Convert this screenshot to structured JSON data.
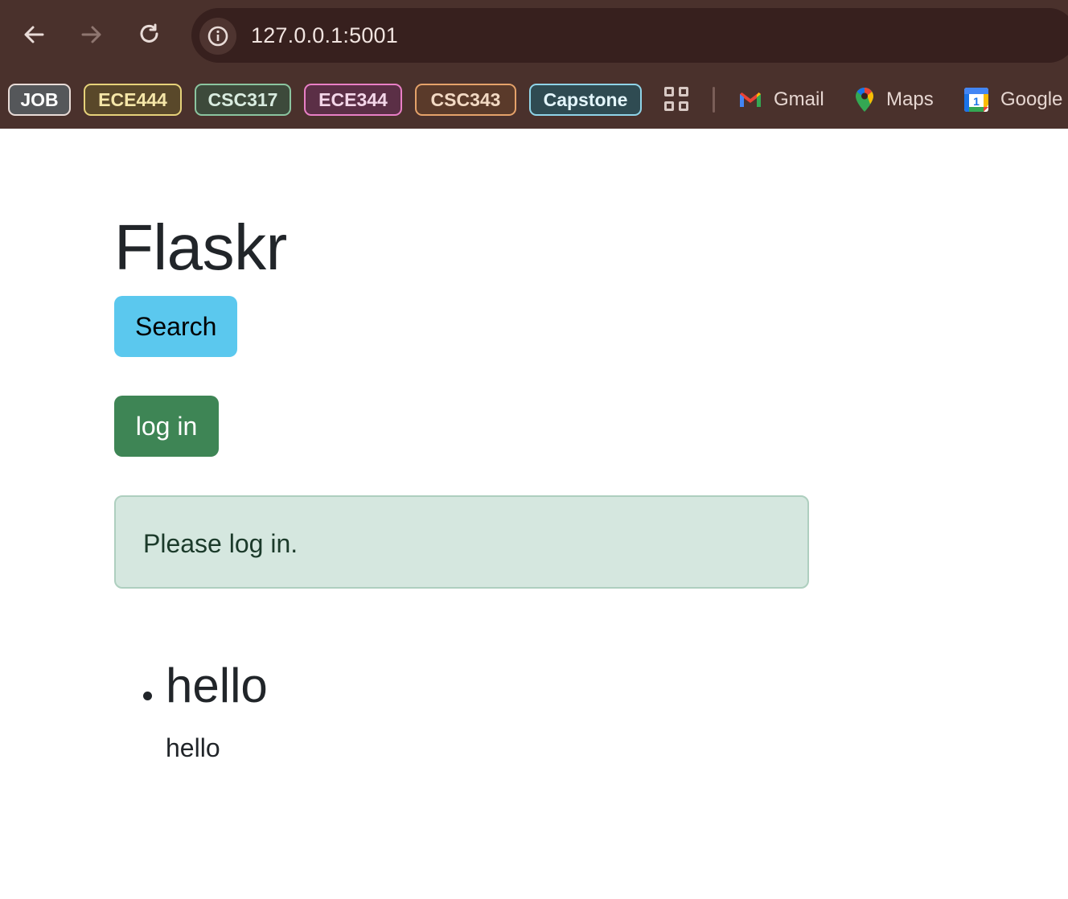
{
  "browser": {
    "url": "127.0.0.1:5001",
    "nav_icons": [
      "back-arrow-icon",
      "forward-arrow-icon",
      "reload-icon",
      "site-info-icon"
    ],
    "bookmarks": {
      "chips": [
        {
          "label": "JOB",
          "border": "#e9dcd8",
          "bg": "#55575a",
          "text": "#ffffff"
        },
        {
          "label": "ECE444",
          "border": "#e6d27a",
          "bg": "#59482a",
          "text": "#f5e6a8"
        },
        {
          "label": "CSC317",
          "border": "#8bc5a0",
          "bg": "#3d4a3b",
          "text": "#d9ece0"
        },
        {
          "label": "ECE344",
          "border": "#e97fc6",
          "bg": "#5b2f46",
          "text": "#f3d6e8"
        },
        {
          "label": "CSC343",
          "border": "#e5a26a",
          "bg": "#5a3a2a",
          "text": "#f2d9c4"
        },
        {
          "label": "Capstone",
          "border": "#8fd4e8",
          "bg": "#2f4b52",
          "text": "#e3f5fb"
        }
      ],
      "links": [
        {
          "label": "Gmail",
          "icon": "gmail-icon"
        },
        {
          "label": "Maps",
          "icon": "maps-icon"
        },
        {
          "label": "Google",
          "icon": "google-calendar-icon"
        }
      ]
    }
  },
  "page": {
    "title": "Flaskr",
    "search_button": "Search",
    "login_button": "log in",
    "alert": "Please log in.",
    "posts": [
      {
        "title": "hello",
        "body": "hello"
      }
    ]
  },
  "colors": {
    "chrome_bg": "#4a312c",
    "omnibox_bg": "#37201e",
    "search_button": "#5bc8ee",
    "login_button": "#3e8555",
    "alert_bg": "#d5e7df",
    "alert_border": "#aecfbf"
  }
}
